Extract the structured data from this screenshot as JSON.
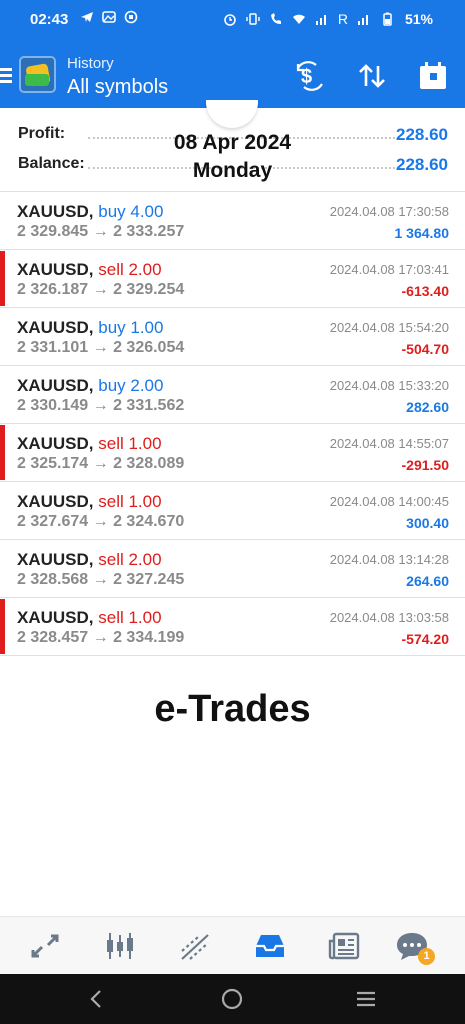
{
  "status_bar": {
    "time": "02:43",
    "network_label": "R",
    "battery": "51%"
  },
  "app_bar": {
    "subtitle": "History",
    "title": "All symbols"
  },
  "summary": {
    "profit_label": "Profit:",
    "profit_value": "228.60",
    "balance_label": "Balance:",
    "balance_value": "228.60",
    "date": "08 Apr 2024",
    "weekday": "Monday"
  },
  "trades": [
    {
      "symbol": "XAUUSD,",
      "side": "buy 4.00",
      "prices": "2 329.845 → 2 333.257",
      "time": "2024.04.08 17:30:58",
      "profit": "1 364.80"
    },
    {
      "symbol": "XAUUSD,",
      "side": "sell 2.00",
      "prices": "2 326.187 → 2 329.254",
      "time": "2024.04.08 17:03:41",
      "profit": "-613.40"
    },
    {
      "symbol": "XAUUSD,",
      "side": "buy 1.00",
      "prices": "2 331.101 → 2 326.054",
      "time": "2024.04.08 15:54:20",
      "profit": "-504.70"
    },
    {
      "symbol": "XAUUSD,",
      "side": "buy 2.00",
      "prices": "2 330.149 → 2 331.562",
      "time": "2024.04.08 15:33:20",
      "profit": "282.60"
    },
    {
      "symbol": "XAUUSD,",
      "side": "sell 1.00",
      "prices": "2 325.174 → 2 328.089",
      "time": "2024.04.08 14:55:07",
      "profit": "-291.50"
    },
    {
      "symbol": "XAUUSD,",
      "side": "sell 1.00",
      "prices": "2 327.674 → 2 324.670",
      "time": "2024.04.08 14:00:45",
      "profit": "300.40"
    },
    {
      "symbol": "XAUUSD,",
      "side": "sell 2.00",
      "prices": "2 328.568 → 2 327.245",
      "time": "2024.04.08 13:14:28",
      "profit": "264.60"
    },
    {
      "symbol": "XAUUSD,",
      "side": "sell 1.00",
      "prices": "2 328.457 → 2 334.199",
      "time": "2024.04.08 13:03:58",
      "profit": "-574.20"
    }
  ],
  "watermark": "e-Trades",
  "bottom_nav": {
    "chat_badge": "1",
    "active": "history"
  },
  "colors": {
    "brand_blue": "#1a78e6",
    "loss_red": "#e01d1d",
    "badge_orange": "#f5a623"
  }
}
